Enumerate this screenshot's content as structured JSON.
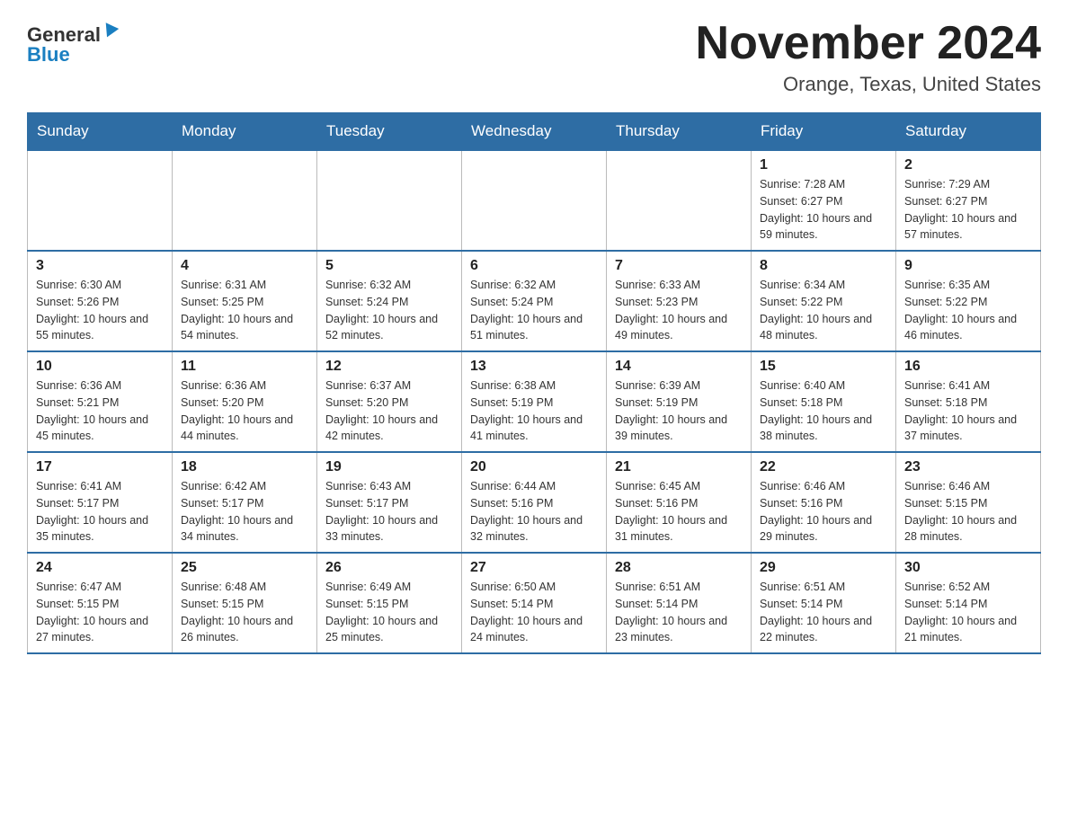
{
  "header": {
    "logo_general": "General",
    "logo_blue": "Blue",
    "title": "November 2024",
    "subtitle": "Orange, Texas, United States"
  },
  "days_of_week": [
    "Sunday",
    "Monday",
    "Tuesday",
    "Wednesday",
    "Thursday",
    "Friday",
    "Saturday"
  ],
  "weeks": [
    [
      {
        "day": "",
        "info": ""
      },
      {
        "day": "",
        "info": ""
      },
      {
        "day": "",
        "info": ""
      },
      {
        "day": "",
        "info": ""
      },
      {
        "day": "",
        "info": ""
      },
      {
        "day": "1",
        "info": "Sunrise: 7:28 AM\nSunset: 6:27 PM\nDaylight: 10 hours and 59 minutes."
      },
      {
        "day": "2",
        "info": "Sunrise: 7:29 AM\nSunset: 6:27 PM\nDaylight: 10 hours and 57 minutes."
      }
    ],
    [
      {
        "day": "3",
        "info": "Sunrise: 6:30 AM\nSunset: 5:26 PM\nDaylight: 10 hours and 55 minutes."
      },
      {
        "day": "4",
        "info": "Sunrise: 6:31 AM\nSunset: 5:25 PM\nDaylight: 10 hours and 54 minutes."
      },
      {
        "day": "5",
        "info": "Sunrise: 6:32 AM\nSunset: 5:24 PM\nDaylight: 10 hours and 52 minutes."
      },
      {
        "day": "6",
        "info": "Sunrise: 6:32 AM\nSunset: 5:24 PM\nDaylight: 10 hours and 51 minutes."
      },
      {
        "day": "7",
        "info": "Sunrise: 6:33 AM\nSunset: 5:23 PM\nDaylight: 10 hours and 49 minutes."
      },
      {
        "day": "8",
        "info": "Sunrise: 6:34 AM\nSunset: 5:22 PM\nDaylight: 10 hours and 48 minutes."
      },
      {
        "day": "9",
        "info": "Sunrise: 6:35 AM\nSunset: 5:22 PM\nDaylight: 10 hours and 46 minutes."
      }
    ],
    [
      {
        "day": "10",
        "info": "Sunrise: 6:36 AM\nSunset: 5:21 PM\nDaylight: 10 hours and 45 minutes."
      },
      {
        "day": "11",
        "info": "Sunrise: 6:36 AM\nSunset: 5:20 PM\nDaylight: 10 hours and 44 minutes."
      },
      {
        "day": "12",
        "info": "Sunrise: 6:37 AM\nSunset: 5:20 PM\nDaylight: 10 hours and 42 minutes."
      },
      {
        "day": "13",
        "info": "Sunrise: 6:38 AM\nSunset: 5:19 PM\nDaylight: 10 hours and 41 minutes."
      },
      {
        "day": "14",
        "info": "Sunrise: 6:39 AM\nSunset: 5:19 PM\nDaylight: 10 hours and 39 minutes."
      },
      {
        "day": "15",
        "info": "Sunrise: 6:40 AM\nSunset: 5:18 PM\nDaylight: 10 hours and 38 minutes."
      },
      {
        "day": "16",
        "info": "Sunrise: 6:41 AM\nSunset: 5:18 PM\nDaylight: 10 hours and 37 minutes."
      }
    ],
    [
      {
        "day": "17",
        "info": "Sunrise: 6:41 AM\nSunset: 5:17 PM\nDaylight: 10 hours and 35 minutes."
      },
      {
        "day": "18",
        "info": "Sunrise: 6:42 AM\nSunset: 5:17 PM\nDaylight: 10 hours and 34 minutes."
      },
      {
        "day": "19",
        "info": "Sunrise: 6:43 AM\nSunset: 5:17 PM\nDaylight: 10 hours and 33 minutes."
      },
      {
        "day": "20",
        "info": "Sunrise: 6:44 AM\nSunset: 5:16 PM\nDaylight: 10 hours and 32 minutes."
      },
      {
        "day": "21",
        "info": "Sunrise: 6:45 AM\nSunset: 5:16 PM\nDaylight: 10 hours and 31 minutes."
      },
      {
        "day": "22",
        "info": "Sunrise: 6:46 AM\nSunset: 5:16 PM\nDaylight: 10 hours and 29 minutes."
      },
      {
        "day": "23",
        "info": "Sunrise: 6:46 AM\nSunset: 5:15 PM\nDaylight: 10 hours and 28 minutes."
      }
    ],
    [
      {
        "day": "24",
        "info": "Sunrise: 6:47 AM\nSunset: 5:15 PM\nDaylight: 10 hours and 27 minutes."
      },
      {
        "day": "25",
        "info": "Sunrise: 6:48 AM\nSunset: 5:15 PM\nDaylight: 10 hours and 26 minutes."
      },
      {
        "day": "26",
        "info": "Sunrise: 6:49 AM\nSunset: 5:15 PM\nDaylight: 10 hours and 25 minutes."
      },
      {
        "day": "27",
        "info": "Sunrise: 6:50 AM\nSunset: 5:14 PM\nDaylight: 10 hours and 24 minutes."
      },
      {
        "day": "28",
        "info": "Sunrise: 6:51 AM\nSunset: 5:14 PM\nDaylight: 10 hours and 23 minutes."
      },
      {
        "day": "29",
        "info": "Sunrise: 6:51 AM\nSunset: 5:14 PM\nDaylight: 10 hours and 22 minutes."
      },
      {
        "day": "30",
        "info": "Sunrise: 6:52 AM\nSunset: 5:14 PM\nDaylight: 10 hours and 21 minutes."
      }
    ]
  ]
}
